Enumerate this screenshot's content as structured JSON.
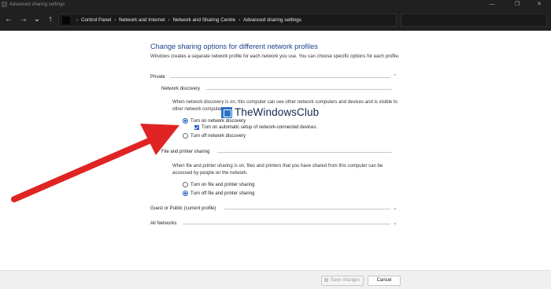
{
  "window": {
    "title": "Advanced sharing settings",
    "controls": {
      "minimize": "—",
      "maximize": "❐",
      "close": "✕"
    }
  },
  "nav": {
    "back": "←",
    "forward": "→",
    "recent": "⌄",
    "up": "↑",
    "breadcrumbs": [
      "Control Panel",
      "Network and Internet",
      "Network and Sharing Centre",
      "Advanced sharing settings"
    ],
    "separator": "›"
  },
  "page": {
    "heading": "Change sharing options for different network profiles",
    "intro": "Windows creates a separate network profile for each network you use. You can choose specific options for each profile."
  },
  "private": {
    "label": "Private",
    "expanded": true,
    "network_discovery": {
      "label": "Network discovery",
      "description": "When network discovery is on, this computer can see other network computers and devices and is visible to other network computers.",
      "options": [
        {
          "label": "Turn on network discovery",
          "checked": true
        },
        {
          "label": "Turn off network discovery",
          "checked": false
        }
      ],
      "auto_setup": {
        "label": "Turn on automatic setup of network-connected devices.",
        "checked": true
      }
    },
    "file_printer_sharing": {
      "label": "File and printer sharing",
      "description": "When file and printer sharing is on, files and printers that you have shared from this computer can be accessed by people on the network.",
      "options": [
        {
          "label": "Turn on file and printer sharing",
          "checked": false
        },
        {
          "label": "Turn off file and printer sharing",
          "checked": true
        }
      ]
    }
  },
  "guest_public": {
    "label": "Guest or Public (current profile)",
    "expanded": false
  },
  "all_networks": {
    "label": "All Networks",
    "expanded": false
  },
  "footer": {
    "save_label": "Save changes",
    "cancel_label": "Cancel"
  },
  "watermark": {
    "text": "TheWindowsClub"
  },
  "colors": {
    "accent": "#1f5fbf",
    "heading": "#1e3f8c",
    "arrow": "#e02424",
    "titlebar": "#202020"
  }
}
